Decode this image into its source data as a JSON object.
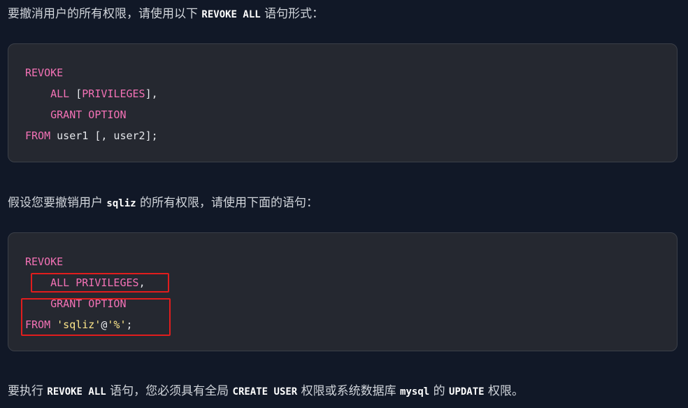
{
  "intro": {
    "prefix": "要撤消用户的所有权限，请使用以下",
    "code": "REVOKE ALL",
    "suffix": "语句形式："
  },
  "block1": {
    "lines": [
      {
        "tokens": [
          {
            "t": "REVOKE",
            "c": "kw"
          }
        ]
      },
      {
        "tokens": [
          {
            "t": "    ",
            "c": "pl"
          },
          {
            "t": "ALL",
            "c": "kw"
          },
          {
            "t": " [",
            "c": "pl"
          },
          {
            "t": "PRIVILEGES",
            "c": "kw"
          },
          {
            "t": "],",
            "c": "pl"
          }
        ]
      },
      {
        "tokens": [
          {
            "t": "    ",
            "c": "pl"
          },
          {
            "t": "GRANT OPTION",
            "c": "kw"
          }
        ]
      },
      {
        "tokens": [
          {
            "t": "FROM",
            "c": "kw"
          },
          {
            "t": " user1 [, user2];",
            "c": "pl"
          }
        ]
      }
    ]
  },
  "middle": {
    "prefix": "假设您要撤销用户",
    "code": "sqliz",
    "suffix": "的所有权限，请使用下面的语句："
  },
  "block2": {
    "lines": [
      {
        "tokens": [
          {
            "t": "REVOKE",
            "c": "kw"
          }
        ]
      },
      {
        "tokens": [
          {
            "t": "    ",
            "c": "pl"
          },
          {
            "t": "ALL PRIVILEGES",
            "c": "kw"
          },
          {
            "t": ",",
            "c": "pl"
          }
        ]
      },
      {
        "tokens": [
          {
            "t": "    ",
            "c": "pl"
          },
          {
            "t": "GRANT OPTION",
            "c": "kw"
          }
        ]
      },
      {
        "tokens": [
          {
            "t": "FROM",
            "c": "kw"
          },
          {
            "t": " ",
            "c": "pl"
          },
          {
            "t": "'sqliz'",
            "c": "str"
          },
          {
            "t": "@",
            "c": "pl"
          },
          {
            "t": "'%'",
            "c": "str"
          },
          {
            "t": ";",
            "c": "pl"
          }
        ]
      }
    ]
  },
  "footer": {
    "p1": "要执行",
    "c1": "REVOKE ALL",
    "p2": "语句，您必须具有全局",
    "c2": "CREATE USER",
    "p3": "权限或系统数据库",
    "c3": "mysql",
    "p4": "的",
    "c4": "UPDATE",
    "p5": "权限。"
  },
  "colors": {
    "background": "#111827",
    "code_background": "#252830",
    "keyword": "#f472b6",
    "string": "#fde68a",
    "highlight_box": "#e11d1d"
  }
}
